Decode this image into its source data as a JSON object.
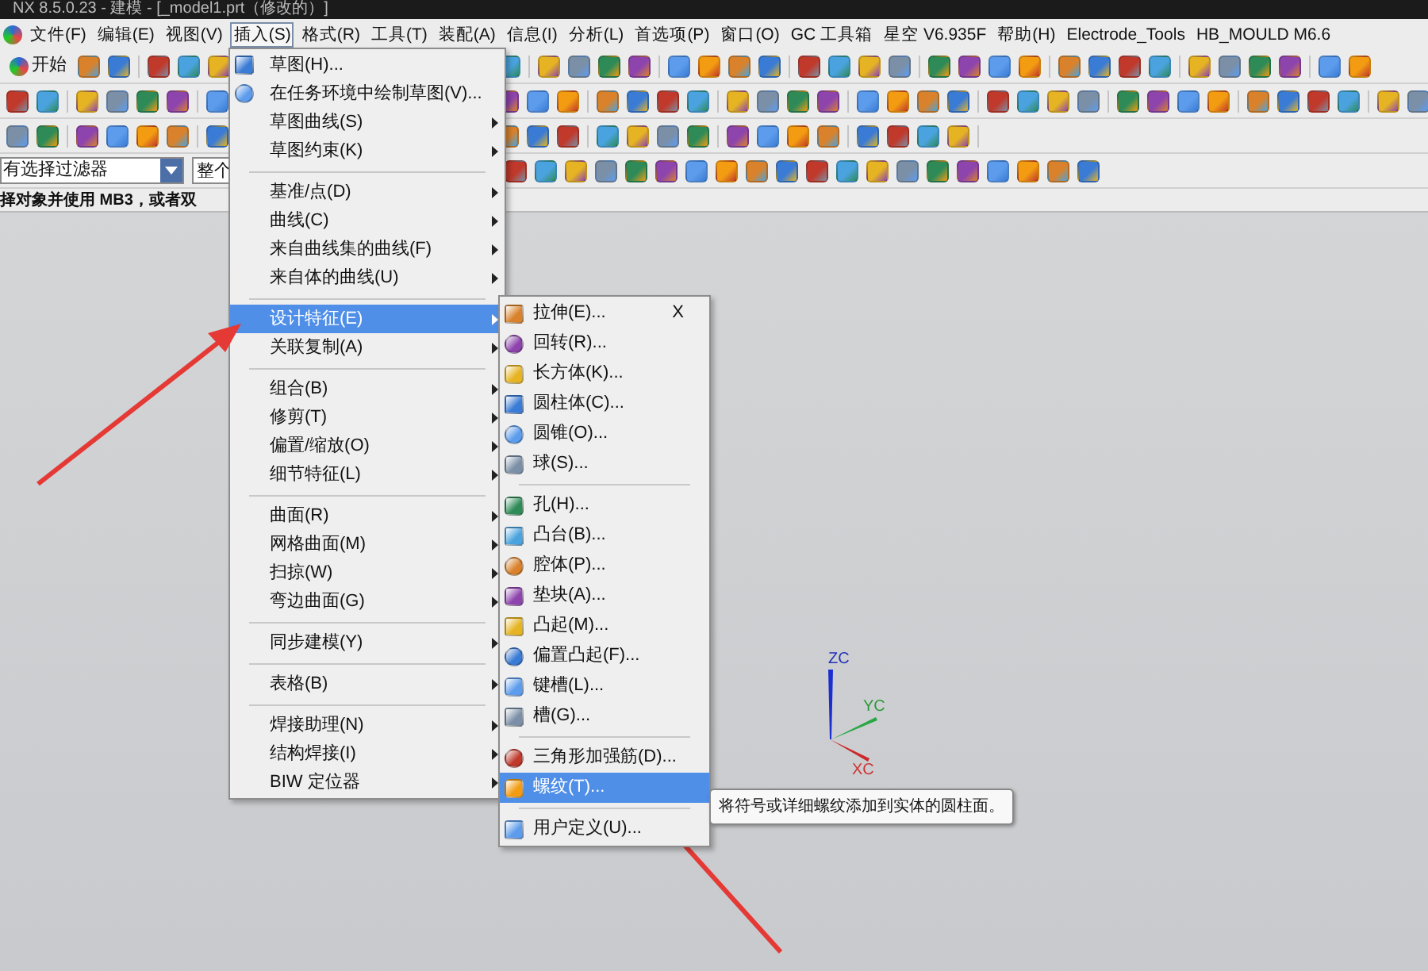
{
  "window": {
    "title": "NX 8.5.0.23 - 建模 - [_model1.prt（修改的）]"
  },
  "menubar": [
    {
      "label": "文件(F)",
      "selected": false
    },
    {
      "label": "编辑(E)",
      "selected": false
    },
    {
      "label": "视图(V)",
      "selected": false
    },
    {
      "label": "插入(S)",
      "selected": true
    },
    {
      "label": "格式(R)",
      "selected": false
    },
    {
      "label": "工具(T)",
      "selected": false
    },
    {
      "label": "装配(A)",
      "selected": false
    },
    {
      "label": "信息(I)",
      "selected": false
    },
    {
      "label": "分析(L)",
      "selected": false
    },
    {
      "label": "首选项(P)",
      "selected": false
    },
    {
      "label": "窗口(O)",
      "selected": false
    },
    {
      "label": "GC 工具箱",
      "selected": false
    },
    {
      "label": "星空 V6.935F",
      "selected": false
    },
    {
      "label": "帮助(H)",
      "selected": false
    },
    {
      "label": "Electrode_Tools",
      "selected": false
    },
    {
      "label": "HB_MOULD M6.6",
      "selected": false
    }
  ],
  "toolbar": {
    "start_button": "开始",
    "filter_dropdown": "有选择过滤器",
    "scope_dropdown": "整个"
  },
  "status_line": "择对象并使用 MB3，或者双",
  "insert_menu": {
    "groups": [
      [
        {
          "label": "草图(H)...",
          "submenu": false,
          "selected": false
        },
        {
          "label": "在任务环境中绘制草图(V)...",
          "submenu": false,
          "selected": false
        },
        {
          "label": "草图曲线(S)",
          "submenu": true,
          "selected": false
        },
        {
          "label": "草图约束(K)",
          "submenu": true,
          "selected": false
        }
      ],
      [
        {
          "label": "基准/点(D)",
          "submenu": true,
          "selected": false
        },
        {
          "label": "曲线(C)",
          "submenu": true,
          "selected": false
        },
        {
          "label": "来自曲线集的曲线(F)",
          "submenu": true,
          "selected": false
        },
        {
          "label": "来自体的曲线(U)",
          "submenu": true,
          "selected": false
        }
      ],
      [
        {
          "label": "设计特征(E)",
          "submenu": true,
          "selected": true
        },
        {
          "label": "关联复制(A)",
          "submenu": true,
          "selected": false
        }
      ],
      [
        {
          "label": "组合(B)",
          "submenu": true,
          "selected": false
        },
        {
          "label": "修剪(T)",
          "submenu": true,
          "selected": false
        },
        {
          "label": "偏置/缩放(O)",
          "submenu": true,
          "selected": false
        },
        {
          "label": "细节特征(L)",
          "submenu": true,
          "selected": false
        }
      ],
      [
        {
          "label": "曲面(R)",
          "submenu": true,
          "selected": false
        },
        {
          "label": "网格曲面(M)",
          "submenu": true,
          "selected": false
        },
        {
          "label": "扫掠(W)",
          "submenu": true,
          "selected": false
        },
        {
          "label": "弯边曲面(G)",
          "submenu": true,
          "selected": false
        }
      ],
      [
        {
          "label": "同步建模(Y)",
          "submenu": true,
          "selected": false
        }
      ],
      [
        {
          "label": "表格(B)",
          "submenu": true,
          "selected": false
        }
      ],
      [
        {
          "label": "焊接助理(N)",
          "submenu": true,
          "selected": false
        },
        {
          "label": "结构焊接(I)",
          "submenu": true,
          "selected": false
        },
        {
          "label": "BIW 定位器",
          "submenu": true,
          "selected": false
        }
      ]
    ]
  },
  "design_feature_menu": {
    "close_mark": "X",
    "groups": [
      [
        {
          "label": "拉伸(E)...",
          "selected": false
        },
        {
          "label": "回转(R)...",
          "selected": false
        },
        {
          "label": "长方体(K)...",
          "selected": false
        },
        {
          "label": "圆柱体(C)...",
          "selected": false
        },
        {
          "label": "圆锥(O)...",
          "selected": false
        },
        {
          "label": "球(S)...",
          "selected": false
        }
      ],
      [
        {
          "label": "孔(H)...",
          "selected": false
        },
        {
          "label": "凸台(B)...",
          "selected": false
        },
        {
          "label": "腔体(P)...",
          "selected": false
        },
        {
          "label": "垫块(A)...",
          "selected": false
        },
        {
          "label": "凸起(M)...",
          "selected": false
        },
        {
          "label": "偏置凸起(F)...",
          "selected": false
        },
        {
          "label": "键槽(L)...",
          "selected": false
        },
        {
          "label": "槽(G)...",
          "selected": false
        }
      ],
      [
        {
          "label": "三角形加强筋(D)...",
          "selected": false
        },
        {
          "label": "螺纹(T)...",
          "selected": true
        }
      ],
      [
        {
          "label": "用户定义(U)...",
          "selected": false
        }
      ]
    ]
  },
  "tooltip": "将符号或详细螺纹添加到实体的圆柱面。",
  "triad": {
    "z": "ZC",
    "y": "YC",
    "x": "XC"
  }
}
